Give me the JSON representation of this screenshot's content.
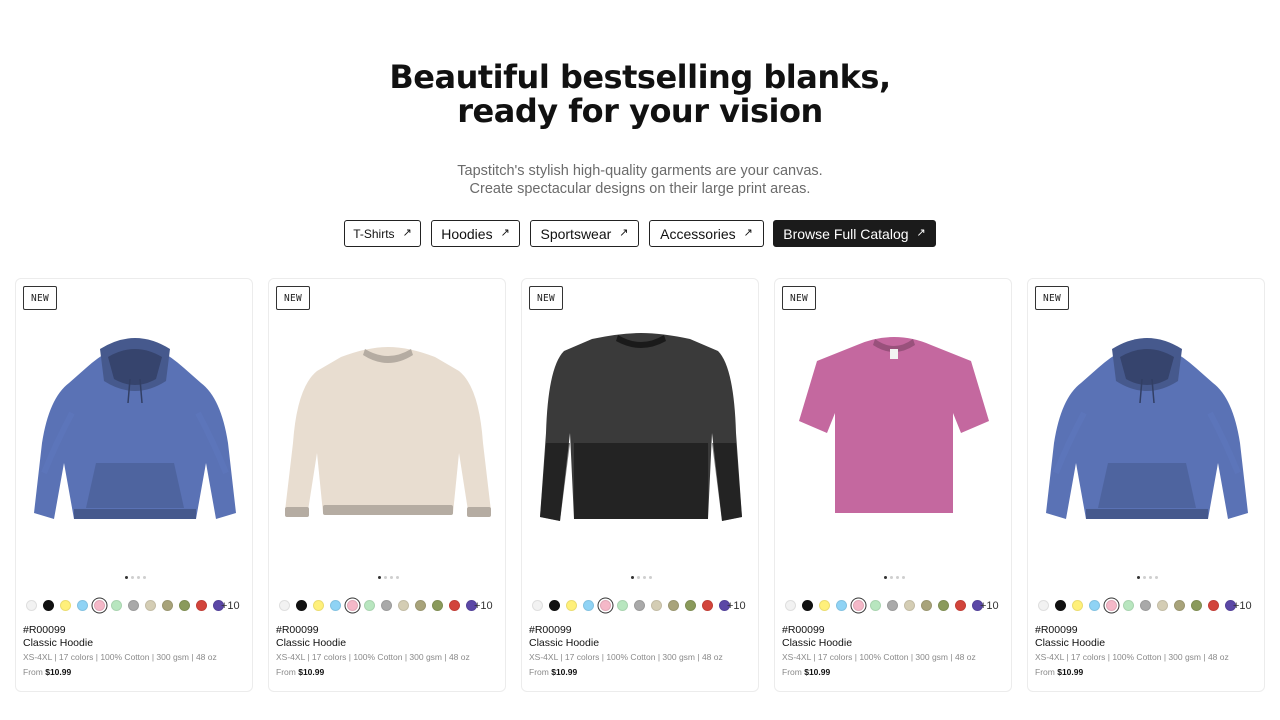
{
  "hero": {
    "title_line1": "Beautiful bestselling blanks,",
    "title_line2": "ready for your vision",
    "subtitle_line1": "Tapstitch's stylish high-quality garments are your canvas.",
    "subtitle_line2": "Create spectacular designs on their large print areas."
  },
  "categories": [
    {
      "label": "T-Shirts",
      "icon": "arrow-up-right-icon"
    },
    {
      "label": "Hoodies",
      "icon": "arrow-up-right-icon"
    },
    {
      "label": "Sportswear",
      "icon": "arrow-up-right-icon"
    },
    {
      "label": "Accessories",
      "icon": "arrow-up-right-icon"
    },
    {
      "label": "Browse Full Catalog",
      "icon": "arrow-up-right-icon"
    }
  ],
  "arrow_glyph": "↗",
  "swatch_colors": [
    "#f2f2f2",
    "#111111",
    "#fff07a",
    "#8fd3f5",
    "#f5b8c8",
    "#b8e6bf",
    "#a9a9a9",
    "#d4cdb4",
    "#a8a37a",
    "#8a9a5b",
    "#d2443b",
    "#5b47a6"
  ],
  "selected_swatch_index": 4,
  "products": [
    {
      "badge": "NEW",
      "image": "blue-hoodie",
      "garment_color": "#5a72b5",
      "sku": "#R00099",
      "name": "Classic Hoodie",
      "specs": "XS-4XL  |  17 colors  |  100% Cotton  |  300 gsm  |  48 oz",
      "price_prefix": "From",
      "price": "$10.99",
      "more_colors": "+10",
      "active_slide": 1,
      "slide_count": 4
    },
    {
      "badge": "NEW",
      "image": "cream-sweatshirt",
      "garment_color": "#e8ddd0",
      "sku": "#R00099",
      "name": "Classic Hoodie",
      "specs": "XS-4XL  |  17 colors  |  100% Cotton  |  300 gsm  |  48 oz",
      "price_prefix": "From",
      "price": "$10.99",
      "more_colors": "+10",
      "active_slide": 1,
      "slide_count": 4
    },
    {
      "badge": "NEW",
      "image": "black-longsleeve",
      "garment_color": "#3a3a3a",
      "sku": "#R00099",
      "name": "Classic Hoodie",
      "specs": "XS-4XL  |  17 colors  |  100% Cotton  |  300 gsm  |  48 oz",
      "price_prefix": "From",
      "price": "$10.99",
      "more_colors": "+10",
      "active_slide": 1,
      "slide_count": 4
    },
    {
      "badge": "NEW",
      "image": "pink-tshirt",
      "garment_color": "#c4689f",
      "sku": "#R00099",
      "name": "Classic Hoodie",
      "specs": "XS-4XL  |  17 colors  |  100% Cotton  |  300 gsm  |  48 oz",
      "price_prefix": "From",
      "price": "$10.99",
      "more_colors": "+10",
      "active_slide": 1,
      "slide_count": 4
    },
    {
      "badge": "NEW",
      "image": "blue-hoodie",
      "garment_color": "#5a72b5",
      "sku": "#R00099",
      "name": "Classic Hoodie",
      "specs": "XS-4XL  |  17 colors  |  100% Cotton  |  300 gsm  |  48 oz",
      "price_prefix": "From",
      "price": "$10.99",
      "more_colors": "+10",
      "active_slide": 1,
      "slide_count": 4
    }
  ]
}
